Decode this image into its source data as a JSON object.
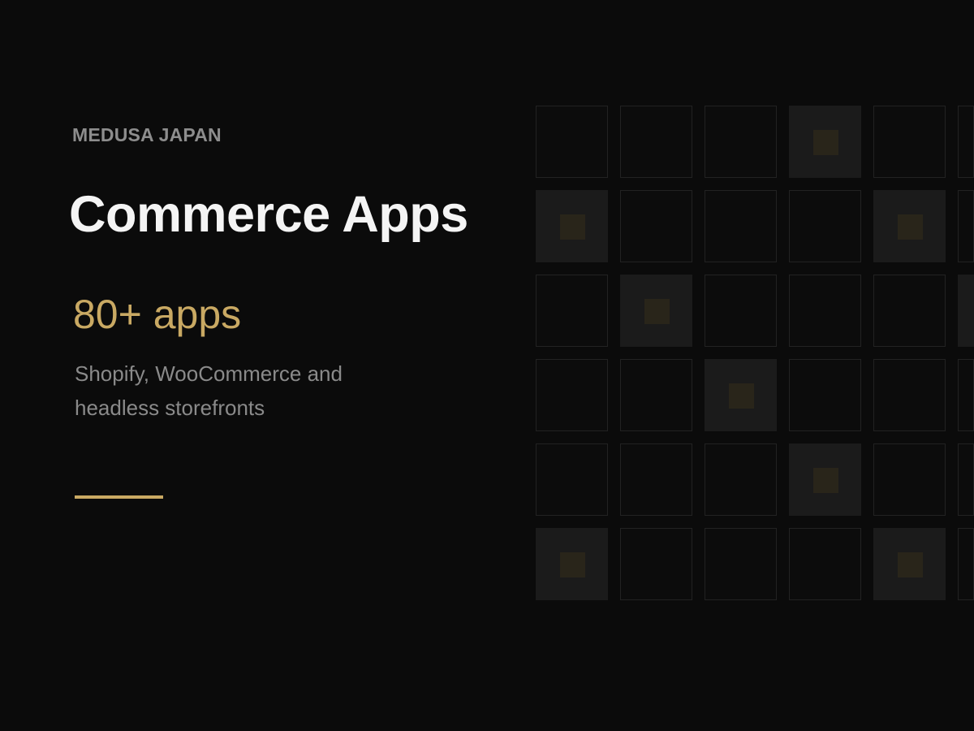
{
  "brand": "MEDUSA JAPAN",
  "title": "Commerce Apps",
  "count": "80+ apps",
  "description": "Shopify, WooCommerce and headless storefronts",
  "colors": {
    "background": "#0b0b0b",
    "accent": "#c9a963",
    "title": "#f4f4f4",
    "muted": "#8a8a8a"
  },
  "decor_grid": {
    "rows": 6,
    "visible_columns": 6,
    "highlighted_cells": [
      [
        0,
        3
      ],
      [
        1,
        0
      ],
      [
        1,
        4
      ],
      [
        2,
        1
      ],
      [
        2,
        5
      ],
      [
        3,
        2
      ],
      [
        4,
        3
      ],
      [
        5,
        0
      ],
      [
        5,
        4
      ]
    ]
  }
}
